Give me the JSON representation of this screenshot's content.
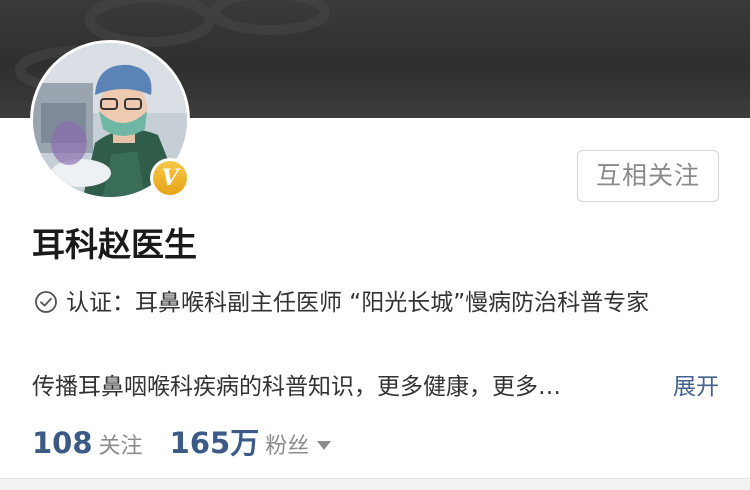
{
  "profile": {
    "name": "耳科赵医生",
    "follow_label": "互相关注",
    "verified_badge_letter": "V",
    "verification": "认证：耳鼻喉科副主任医师 “阳光长城”慢病防治科普专家",
    "bio": "传播耳鼻咽喉科疾病的科普知识，更多健康，更多…",
    "expand_label": "展开",
    "stats": {
      "following_count": "108",
      "following_label": "关注",
      "followers_count": "165万",
      "followers_label": "粉丝"
    }
  },
  "icons": {
    "verify": "check-circle-icon",
    "followers_menu": "caret-down-icon",
    "badge": "verified-v-icon"
  },
  "colors": {
    "banner": "#333333",
    "link": "#44638f",
    "stat_number": "#3b5b86",
    "badge": "#f0b429",
    "muted": "#8c8c8c"
  }
}
